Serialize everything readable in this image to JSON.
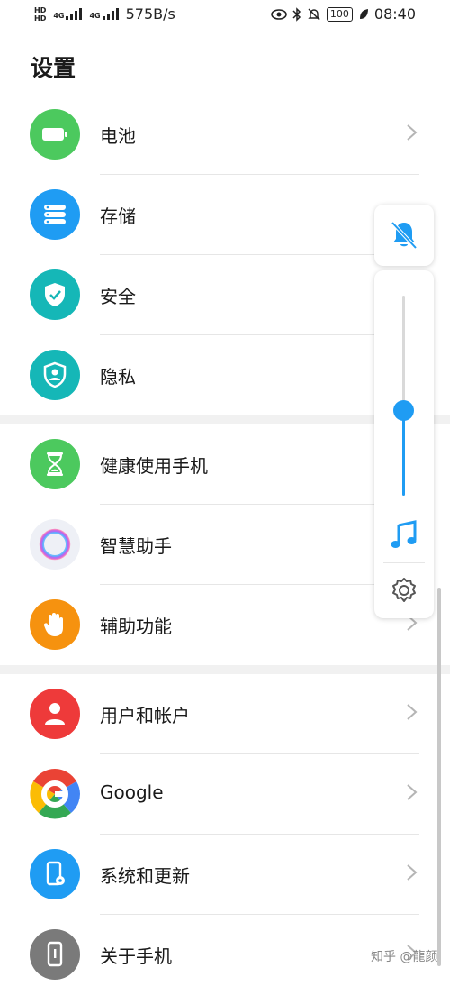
{
  "status_bar": {
    "hd1": "HD",
    "hd2": "HD",
    "net1": "4G",
    "net2": "4G",
    "speed": "575B/s",
    "battery": "100",
    "time": "08:40"
  },
  "page": {
    "title": "设置"
  },
  "items": [
    {
      "label": "电池",
      "color": "#4cc95e",
      "icon": "battery-icon"
    },
    {
      "label": "存储",
      "color": "#1f9cf3",
      "icon": "storage-icon"
    },
    {
      "label": "安全",
      "color": "#15b7b7",
      "icon": "shield-icon"
    },
    {
      "label": "隐私",
      "color": "#15b7b7",
      "icon": "privacy-icon"
    },
    {
      "label": "健康使用手机",
      "color": "#4cc95e",
      "icon": "hourglass-icon"
    },
    {
      "label": "智慧助手",
      "color": "#eef0f6",
      "icon": "assistant-icon"
    },
    {
      "label": "辅助功能",
      "color": "#f6920f",
      "icon": "hand-icon"
    },
    {
      "label": "用户和帐户",
      "color": "#ee3a3a",
      "icon": "user-icon"
    },
    {
      "label": "Google",
      "color": "#ffffff",
      "icon": "google-icon"
    },
    {
      "label": "系统和更新",
      "color": "#1f9cf3",
      "icon": "phone-settings-icon"
    },
    {
      "label": "关于手机",
      "color": "#7a7a7a",
      "icon": "phone-info-icon"
    }
  ],
  "volume": {
    "level": 0.43,
    "accent": "#1f9cf3"
  },
  "watermark": "知乎 @龍颜"
}
